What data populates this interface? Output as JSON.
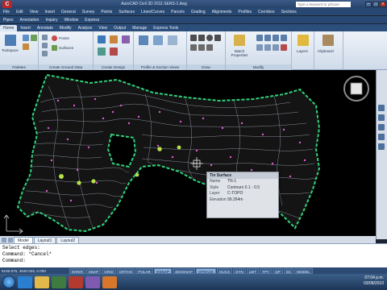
{
  "titlebar": {
    "title": "AutoCAD Civil 3D 2011   SERS-1.dwg",
    "search_placeholder": "Type a keyword or phrase",
    "minimize": "–",
    "maximize": "□",
    "close": "×"
  },
  "menu_primary": [
    "File",
    "Edit",
    "View",
    "Insert",
    "General",
    "Survey",
    "Points",
    "Surfaces",
    "Lines/Curves",
    "Parcels",
    "Grading",
    "Alignments",
    "Profiles",
    "Corridors",
    "Sections"
  ],
  "menu_secondary": [
    "Pipes",
    "Annotation",
    "Inquiry",
    "Window",
    "Express"
  ],
  "ribbon_tabs": [
    "Home",
    "Insert",
    "Annotate",
    "Modify",
    "Analyze",
    "View",
    "Output",
    "Manage",
    "Express Tools"
  ],
  "ribbon": {
    "toolspace": "Toolspace",
    "points": "Points",
    "surfaces": "Surfaces",
    "match_properties": "Match Properties",
    "layers": "Layers",
    "clipboard": "Clipboard",
    "panels": [
      "Palettes",
      "Create Ground Data",
      "Create Design",
      "Profile & Section Views",
      "Draw",
      "Modify"
    ]
  },
  "tooltip": {
    "header": "Tin Surface",
    "rows": [
      {
        "k": "Name",
        "v": "TN-1"
      },
      {
        "k": "Style",
        "v": "Contours 0.1 - 0.5"
      },
      {
        "k": "Layer",
        "v": "C-TOPO"
      },
      {
        "k": "Elevation",
        "v": "99.264m"
      }
    ]
  },
  "layout_tabs": [
    "Model",
    "Layout1",
    "Layout2"
  ],
  "command_lines": [
    "Select edges:",
    "Command: *Cancel*",
    "Command:"
  ],
  "status": {
    "coords": "5100.676, 4940.025, 0.000",
    "toggles": [
      "INFER",
      "SNAP",
      "GRID",
      "ORTHO",
      "POLAR",
      "OSNAP",
      "3DOSNAP",
      "OTRACK",
      "DUCS",
      "DYN",
      "LWT",
      "TPY",
      "QP",
      "SC",
      "MODEL"
    ]
  },
  "clock": {
    "time": "07:04 p.m.",
    "date": "03/08/2010"
  }
}
